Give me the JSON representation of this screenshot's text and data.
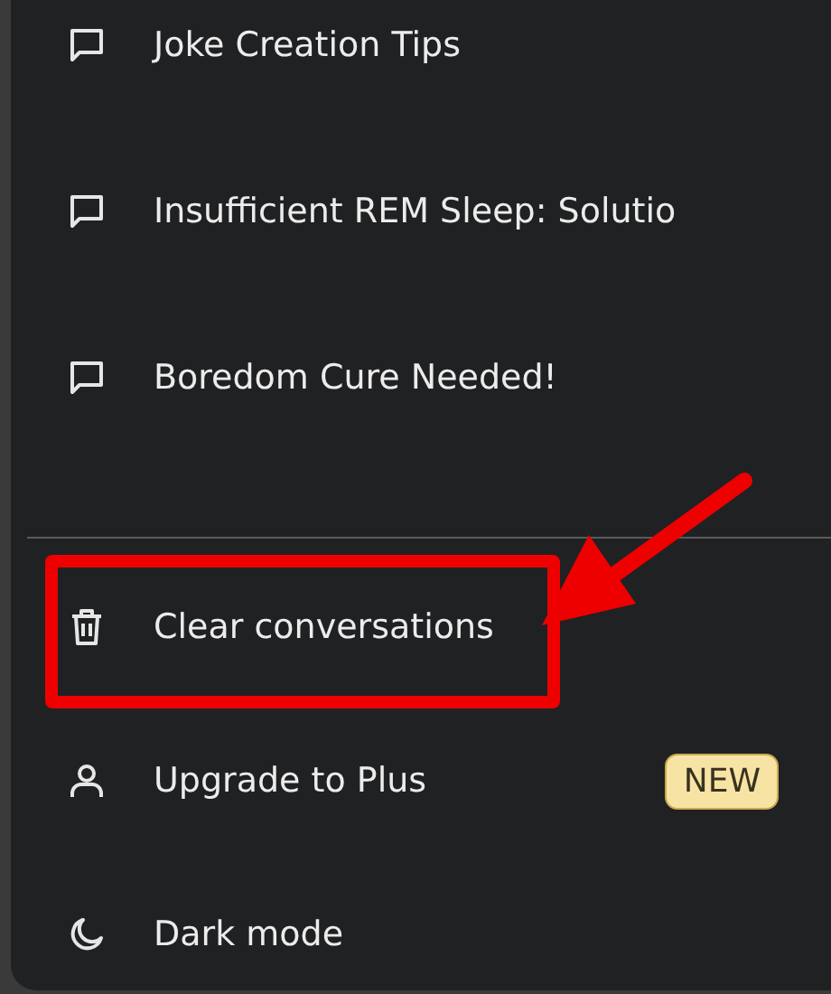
{
  "history": [
    {
      "title": "Joke Creation Tips"
    },
    {
      "title": "Insufficient REM Sleep: Solutio"
    },
    {
      "title": "Boredom Cure Needed!"
    }
  ],
  "menu": [
    {
      "kind": "trash",
      "label": "Clear conversations",
      "highlighted": true
    },
    {
      "kind": "user",
      "label": "Upgrade to Plus",
      "badge": "NEW",
      "highlighted": false
    },
    {
      "kind": "moon",
      "label": "Dark mode",
      "highlighted": false
    }
  ]
}
